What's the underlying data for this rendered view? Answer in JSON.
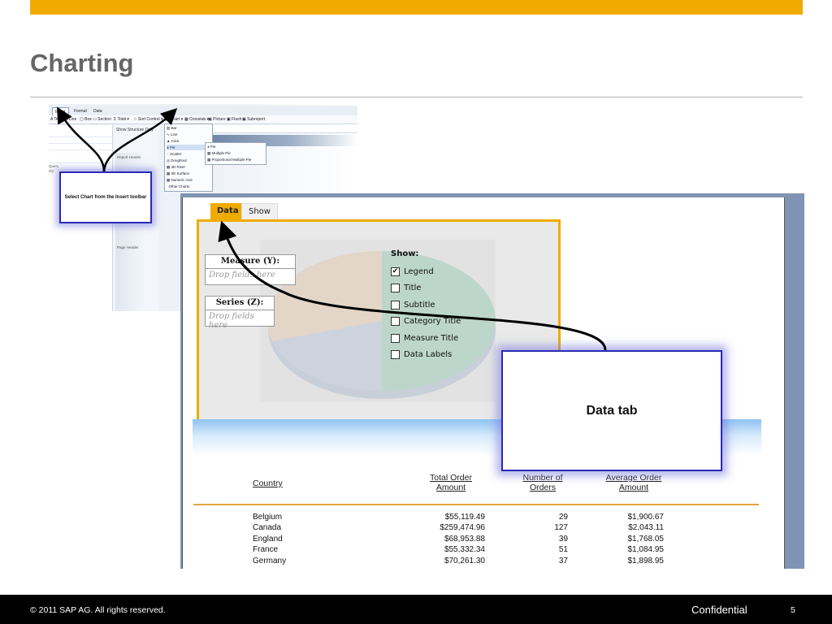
{
  "slide": {
    "title": "Charting",
    "accent_color": "#f0ab00",
    "footer": {
      "copyright": "© 2011 SAP AG. All rights reserved.",
      "confidential": "Confidential",
      "page_number": "5"
    }
  },
  "toolbar_screenshot": {
    "tabs": [
      "Insert",
      "Format",
      "Data"
    ],
    "tools": [
      "Text",
      "Line",
      "Box",
      "Section",
      "Total",
      "Sort Control",
      "Chart",
      "Crosstab",
      "Picture",
      "Flash",
      "Subreport"
    ],
    "side_label": "Show Structure Only",
    "left_pane_words": [
      "Query",
      "ery"
    ],
    "chart_menu": [
      "Bar",
      "Line",
      "Area",
      "Pie",
      "Scatter",
      "Doughnut",
      "3D Riser",
      "3D Surface",
      "Numeric Axis",
      "Other Charts"
    ],
    "pie_submenu": [
      "Pie",
      "Multiple Pie",
      "Proportional Multiple Pie"
    ],
    "report_header_label": "Report Header",
    "page_header_label": "Page Header",
    "callout": "Select Chart from the Insert toolbar"
  },
  "report_screenshot": {
    "tabs": [
      {
        "label": "Data",
        "selected": true
      },
      {
        "label": "Show Chart",
        "selected": false
      }
    ],
    "measure_panel": {
      "header": "Measure (Y):",
      "placeholder": "Drop fields here"
    },
    "series_panel": {
      "header": "Series (Z):",
      "placeholder": "Drop fields here"
    },
    "show_options": {
      "heading": "Show:",
      "items": [
        {
          "label": "Legend",
          "checked": true
        },
        {
          "label": "Title",
          "checked": false
        },
        {
          "label": "Subtitle",
          "checked": false
        },
        {
          "label": "Category Title",
          "checked": false
        },
        {
          "label": "Measure Title",
          "checked": false
        },
        {
          "label": "Data Labels",
          "checked": false
        }
      ]
    },
    "table": {
      "columns": {
        "country": "Country",
        "total_1": "Total Order",
        "total_2": "Amount",
        "number_1": "Number of",
        "number_2": "Orders",
        "average_1": "Average Order",
        "average_2": "Amount"
      },
      "rows": [
        {
          "country": "Belgium",
          "total": "$55,119.49",
          "orders": "29",
          "average": "$1,900.67"
        },
        {
          "country": "Canada",
          "total": "$259,474.96",
          "orders": "127",
          "average": "$2,043.11"
        },
        {
          "country": "England",
          "total": "$68,953.88",
          "orders": "39",
          "average": "$1,768.05"
        },
        {
          "country": "France",
          "total": "$55,332.34",
          "orders": "51",
          "average": "$1,084.95"
        },
        {
          "country": "Germany",
          "total": "$70,261.30",
          "orders": "37",
          "average": "$1,898.95"
        }
      ]
    },
    "callout": "Data tab"
  }
}
